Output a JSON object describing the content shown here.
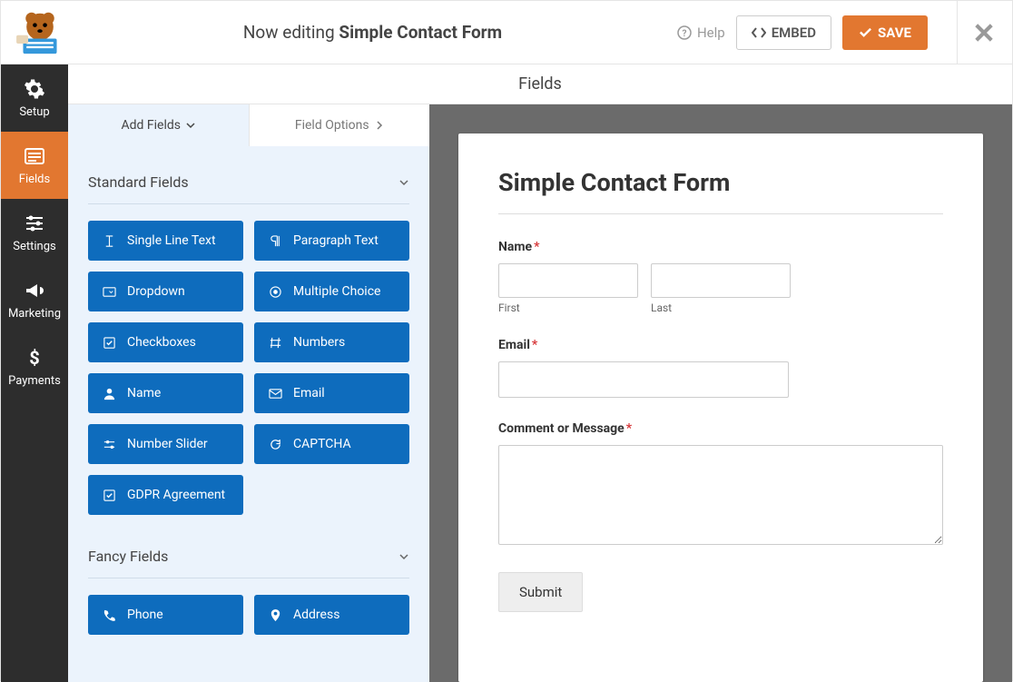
{
  "header": {
    "now_editing": "Now editing",
    "form_name": "Simple Contact Form",
    "help": "Help",
    "embed": "EMBED",
    "save": "SAVE"
  },
  "sidebar": {
    "items": [
      {
        "label": "Setup"
      },
      {
        "label": "Fields"
      },
      {
        "label": "Settings"
      },
      {
        "label": "Marketing"
      },
      {
        "label": "Payments"
      }
    ]
  },
  "panel": {
    "title": "Fields",
    "tabs": {
      "add": "Add Fields",
      "options": "Field Options"
    },
    "sections": {
      "standard": {
        "title": "Standard Fields",
        "fields": [
          "Single Line Text",
          "Paragraph Text",
          "Dropdown",
          "Multiple Choice",
          "Checkboxes",
          "Numbers",
          "Name",
          "Email",
          "Number Slider",
          "CAPTCHA",
          "GDPR Agreement"
        ]
      },
      "fancy": {
        "title": "Fancy Fields",
        "fields": [
          "Phone",
          "Address"
        ]
      }
    }
  },
  "form": {
    "title": "Simple Contact Form",
    "name": {
      "label": "Name",
      "first": "First",
      "last": "Last"
    },
    "email": {
      "label": "Email"
    },
    "comment": {
      "label": "Comment or Message"
    },
    "submit": "Submit"
  }
}
